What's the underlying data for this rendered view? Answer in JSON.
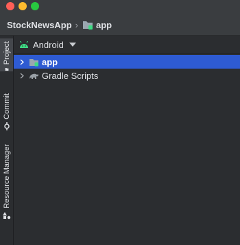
{
  "breadcrumb": {
    "project": "StockNewsApp",
    "module": "app"
  },
  "sidebar": {
    "tabs": [
      {
        "label": "Project",
        "icon": "folder-icon",
        "active": true
      },
      {
        "label": "Commit",
        "icon": "commit-icon",
        "active": false
      },
      {
        "label": "Resource Manager",
        "icon": "resource-manager-icon",
        "active": false
      }
    ]
  },
  "project_panel": {
    "view_label": "Android",
    "tree": [
      {
        "label": "app",
        "icon": "module-folder-icon",
        "selected": true,
        "expanded": false
      },
      {
        "label": "Gradle Scripts",
        "icon": "gradle-icon",
        "selected": false,
        "expanded": false
      }
    ]
  },
  "colors": {
    "selection": "#2e5bd3",
    "android_green": "#3ddc84",
    "background": "#2b2d30"
  }
}
